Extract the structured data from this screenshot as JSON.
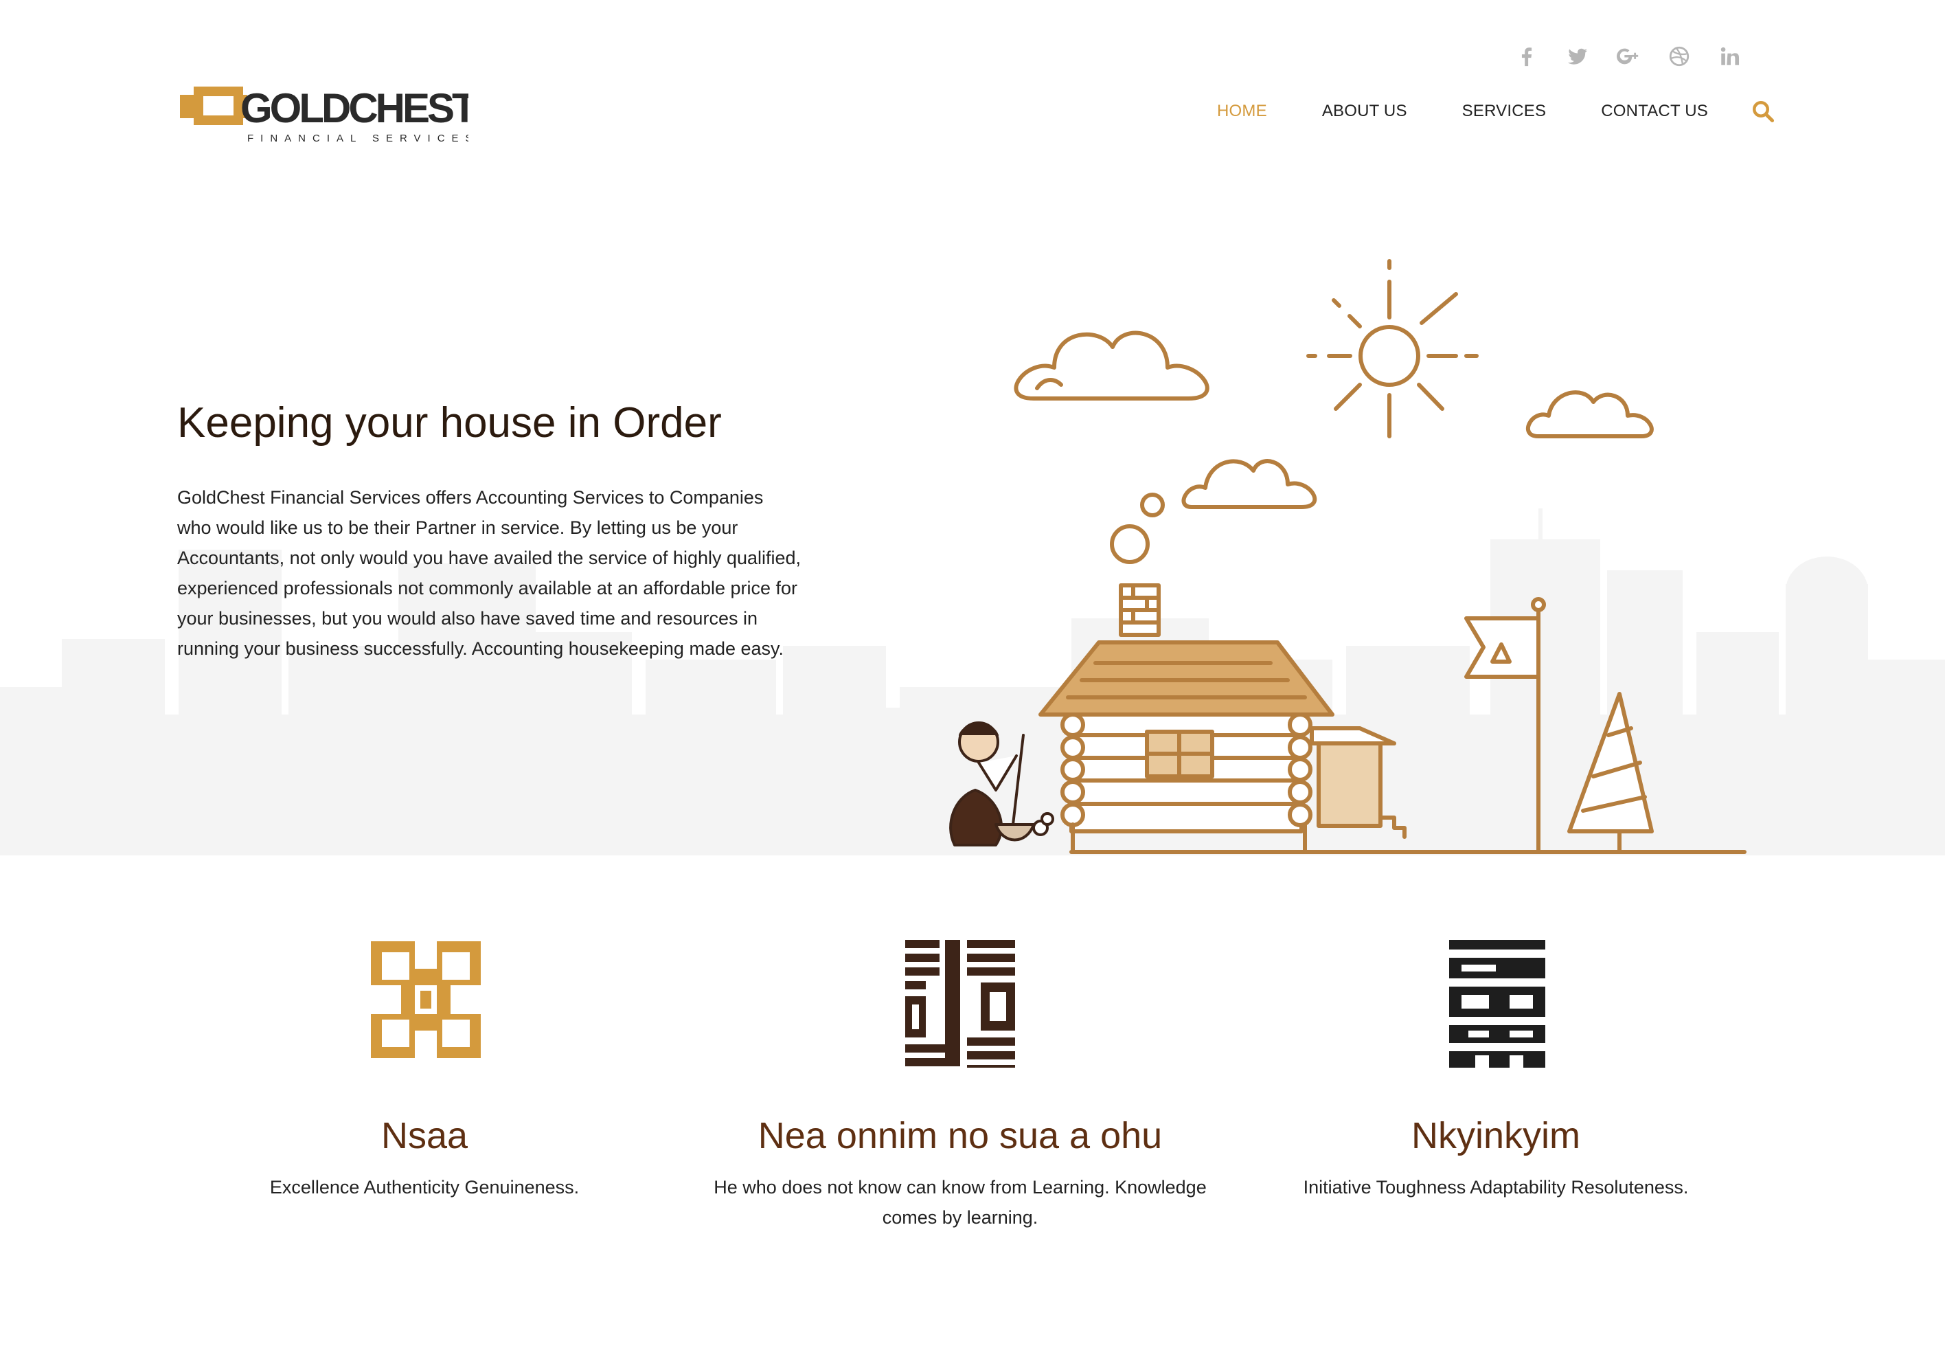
{
  "brand": {
    "name": "GOLDCHEST",
    "tagline": "FINANCIAL SERVICES",
    "accent_color": "#d49a3d"
  },
  "social": [
    {
      "icon": "facebook-icon"
    },
    {
      "icon": "twitter-icon"
    },
    {
      "icon": "google-plus-icon"
    },
    {
      "icon": "dribbble-icon"
    },
    {
      "icon": "linkedin-icon"
    }
  ],
  "nav": {
    "items": [
      {
        "label": "HOME",
        "active": true
      },
      {
        "label": "ABOUT US",
        "active": false
      },
      {
        "label": "SERVICES",
        "active": false
      },
      {
        "label": "CONTACT US",
        "active": false
      }
    ],
    "search_icon": "search-icon"
  },
  "hero": {
    "title": "Keeping your house in Order",
    "body": "GoldChest Financial Services offers Accounting Services to Companies who would like us to be their Partner in service. By letting us be your Accountants, not only would you have availed the service of highly qualified, experienced professionals not commonly available at an affordable price for your businesses, but you would also have saved time and resources in running your business successfully. Accounting housekeeping made easy."
  },
  "features": [
    {
      "title": "Nsaa",
      "text": "Excellence Authenticity Genuineness.",
      "icon": "nsaa-symbol-icon",
      "color": "#d49a3d"
    },
    {
      "title": "Nea onnim no sua a ohu",
      "text": "He who does not know can know from Learning. Knowledge comes by learning.",
      "icon": "nea-onnim-symbol-icon",
      "color": "#3d2418"
    },
    {
      "title": "Nkyinkyim",
      "text": "Initiative Toughness Adaptability Resoluteness.",
      "icon": "nkyinkyim-symbol-icon",
      "color": "#1e1e1e"
    }
  ]
}
